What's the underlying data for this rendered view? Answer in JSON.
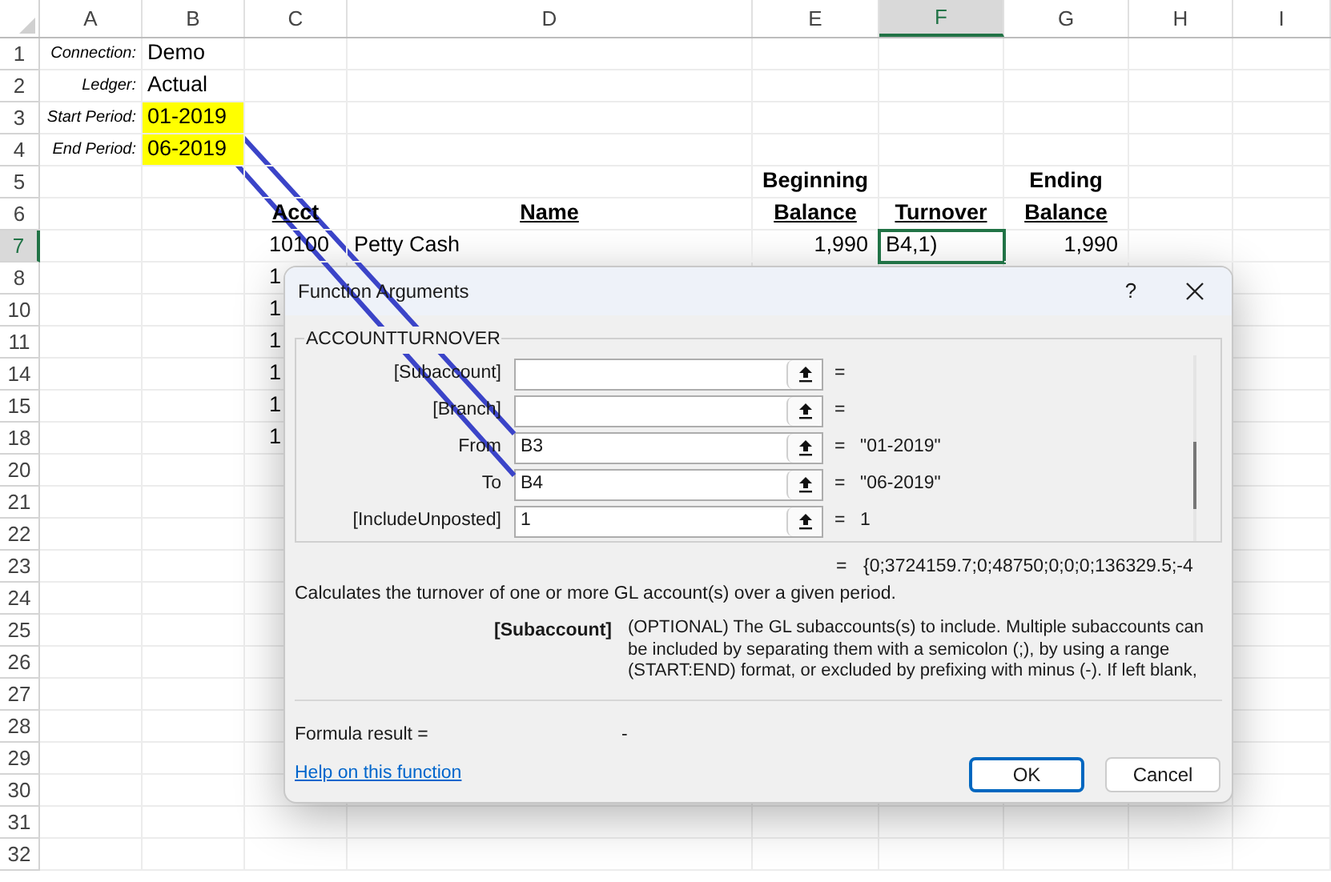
{
  "sheet": {
    "columns": [
      {
        "label": "A",
        "selected": false
      },
      {
        "label": "B",
        "selected": false
      },
      {
        "label": "C",
        "selected": false
      },
      {
        "label": "D",
        "selected": false
      },
      {
        "label": "E",
        "selected": false
      },
      {
        "label": "F",
        "selected": true
      },
      {
        "label": "G",
        "selected": false
      },
      {
        "label": "H",
        "selected": false
      },
      {
        "label": "I",
        "selected": false
      }
    ],
    "rows": [
      {
        "label": "1",
        "selected": false,
        "kind": "param",
        "cells": [
          {
            "text": "Connection:"
          },
          {
            "text": "Demo",
            "highlighted": false
          }
        ]
      },
      {
        "label": "2",
        "selected": false,
        "kind": "param",
        "cells": [
          {
            "text": "Ledger:"
          },
          {
            "text": "Actual",
            "highlighted": false
          }
        ]
      },
      {
        "label": "3",
        "selected": false,
        "kind": "param",
        "cells": [
          {
            "text": "Start Period:"
          },
          {
            "text": "01-2019",
            "highlighted": true
          }
        ]
      },
      {
        "label": "4",
        "selected": false,
        "kind": "param",
        "cells": [
          {
            "text": "End Period:"
          },
          {
            "text": "06-2019",
            "highlighted": true
          }
        ]
      },
      {
        "label": "5",
        "selected": false,
        "kind": "header",
        "cells": [
          null,
          null,
          null,
          null,
          {
            "text": "Beginning"
          },
          null,
          {
            "text": "Ending"
          }
        ]
      },
      {
        "label": "6",
        "selected": false,
        "kind": "underlined_header",
        "cells": [
          null,
          null,
          {
            "text": "Acct"
          },
          {
            "text": "Name"
          },
          {
            "text": "Balance"
          },
          {
            "text": "Turnover"
          },
          {
            "text": "Balance"
          }
        ]
      },
      {
        "label": "7",
        "selected": true,
        "kind": "data",
        "cells": [
          null,
          null,
          {
            "text": "10100"
          },
          {
            "text": "Petty Cash"
          },
          {
            "text": "1,990"
          },
          {
            "text": "B4,1)",
            "active": true
          },
          {
            "text": "1,990"
          }
        ]
      },
      {
        "label": "8",
        "selected": false,
        "kind": "data",
        "cells": [
          null,
          null,
          {
            "text": "1"
          }
        ]
      },
      {
        "label": "10",
        "selected": false,
        "kind": "data",
        "cells": [
          null,
          null,
          {
            "text": "1"
          }
        ]
      },
      {
        "label": "11",
        "selected": false,
        "kind": "data",
        "cells": [
          null,
          null,
          {
            "text": "1"
          }
        ]
      },
      {
        "label": "14",
        "selected": false,
        "kind": "data",
        "cells": [
          null,
          null,
          {
            "text": "1"
          }
        ]
      },
      {
        "label": "15",
        "selected": false,
        "kind": "data",
        "cells": [
          null,
          null,
          {
            "text": "1"
          }
        ]
      },
      {
        "label": "18",
        "selected": false,
        "kind": "data",
        "cells": [
          null,
          null,
          {
            "text": "1"
          }
        ]
      },
      {
        "label": "20",
        "selected": false,
        "kind": "data",
        "cells": []
      },
      {
        "label": "21",
        "selected": false,
        "kind": "data",
        "cells": []
      },
      {
        "label": "22",
        "selected": false,
        "kind": "data",
        "cells": []
      },
      {
        "label": "23",
        "selected": false,
        "kind": "data",
        "cells": []
      },
      {
        "label": "24",
        "selected": false,
        "kind": "data",
        "cells": []
      },
      {
        "label": "25",
        "selected": false,
        "kind": "data",
        "cells": []
      },
      {
        "label": "26",
        "selected": false,
        "kind": "data",
        "cells": []
      },
      {
        "label": "27",
        "selected": false,
        "kind": "data",
        "cells": []
      },
      {
        "label": "28",
        "selected": false,
        "kind": "data",
        "cells": []
      },
      {
        "label": "29",
        "selected": false,
        "kind": "data",
        "cells": []
      },
      {
        "label": "30",
        "selected": false,
        "kind": "data",
        "cells": []
      },
      {
        "label": "31",
        "selected": false,
        "kind": "data",
        "cells": []
      },
      {
        "label": "32",
        "selected": false,
        "kind": "data",
        "cells": []
      }
    ]
  },
  "dialog": {
    "title": "Function Arguments",
    "help_button": "?",
    "function_name": "ACCOUNTTURNOVER",
    "arguments": [
      {
        "label": "[Subaccount]",
        "equals": "="
      },
      {
        "label": "[Branch]",
        "equals": "="
      },
      {
        "label": "From",
        "value": "B3",
        "equals": "=",
        "result": "\"01-2019\""
      },
      {
        "label": "To",
        "value": "B4",
        "equals": "=",
        "result": "\"06-2019\""
      },
      {
        "label": "[IncludeUnposted]",
        "value": "1",
        "equals": "=",
        "result": "1"
      }
    ],
    "formula_equals": "=",
    "formula_value": "{0;3724159.7;0;48750;0;0;0;136329.5;-4",
    "description": "Calculates the turnover of one or more GL account(s) over a given period.",
    "current_argument": {
      "name": "[Subaccount]",
      "lines": [
        "(OPTIONAL) The GL subaccounts(s) to include. Multiple subaccounts can",
        "be included by separating them with a semicolon (;), by using a range",
        "(START:END) format, or excluded by prefixing with minus (-). If left blank,"
      ]
    },
    "formula_result": {
      "label": "Formula result =",
      "value": "-"
    },
    "help_link": "Help on this function",
    "buttons": [
      {
        "label": "OK",
        "default": true
      },
      {
        "label": "Cancel",
        "default": false
      }
    ]
  }
}
